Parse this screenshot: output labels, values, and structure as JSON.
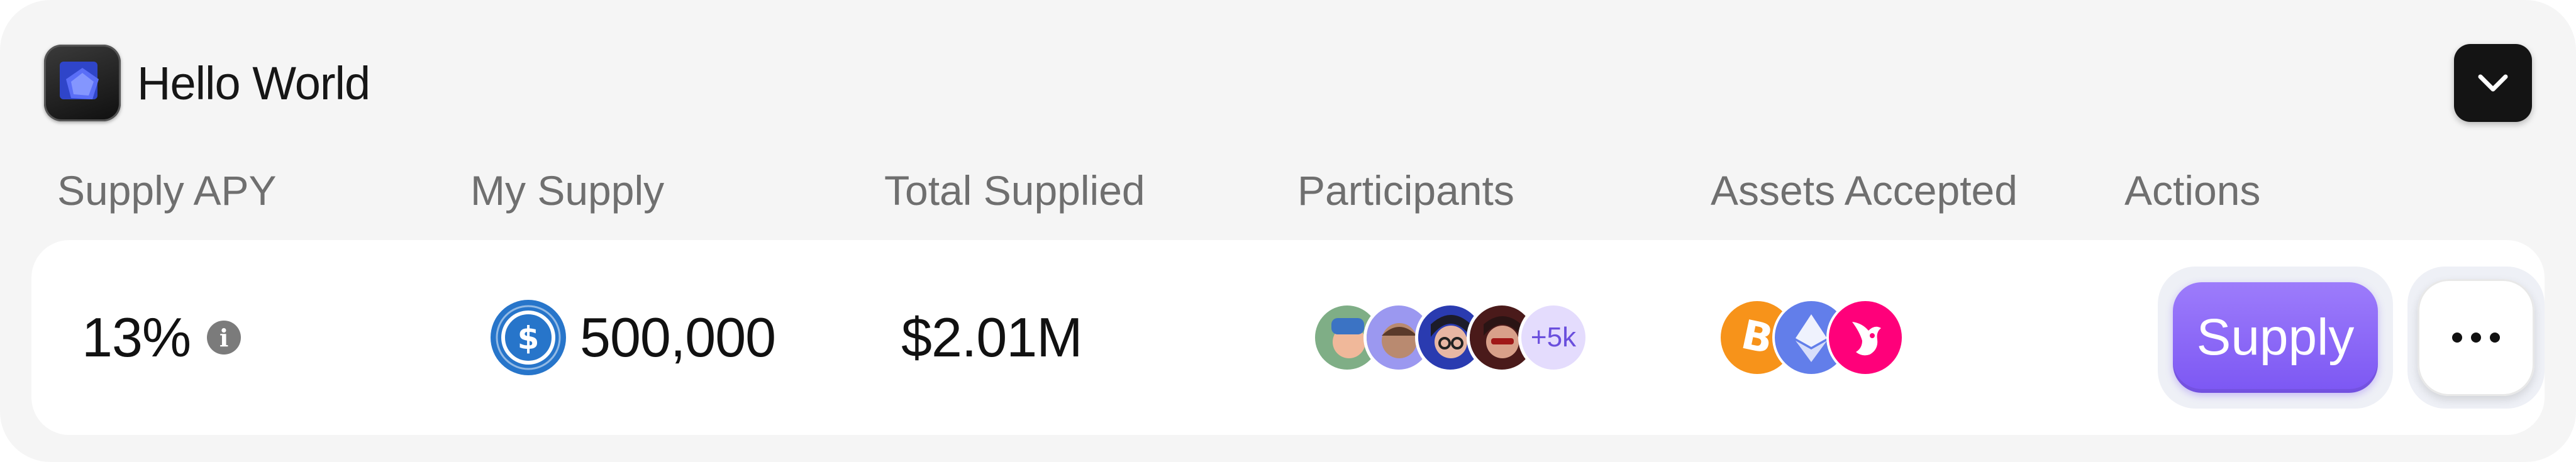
{
  "header": {
    "title": "Hello World",
    "app_icon": "app-logo-icon",
    "collapse_icon": "chevron-down-icon"
  },
  "columns": [
    "Supply APY",
    "My Supply",
    "Total Supplied",
    "Participants",
    "Assets Accepted",
    "Actions"
  ],
  "row": {
    "supply_apy": "13%",
    "my_supply": {
      "token_icon": "usdc-icon",
      "amount": "500,000"
    },
    "total_supplied": "$2.01M",
    "participants": {
      "avatar_count": 4,
      "more_label": "+5k"
    },
    "assets": [
      "bitcoin-icon",
      "ethereum-icon",
      "uniswap-icon"
    ],
    "actions": {
      "supply_label": "Supply",
      "more_icon": "more-dots-icon"
    }
  },
  "colors": {
    "accent": "#7c57f3",
    "usdc": "#2775ca",
    "bitcoin": "#f7931a",
    "ethereum": "#627eea",
    "uniswap": "#ff007a"
  }
}
